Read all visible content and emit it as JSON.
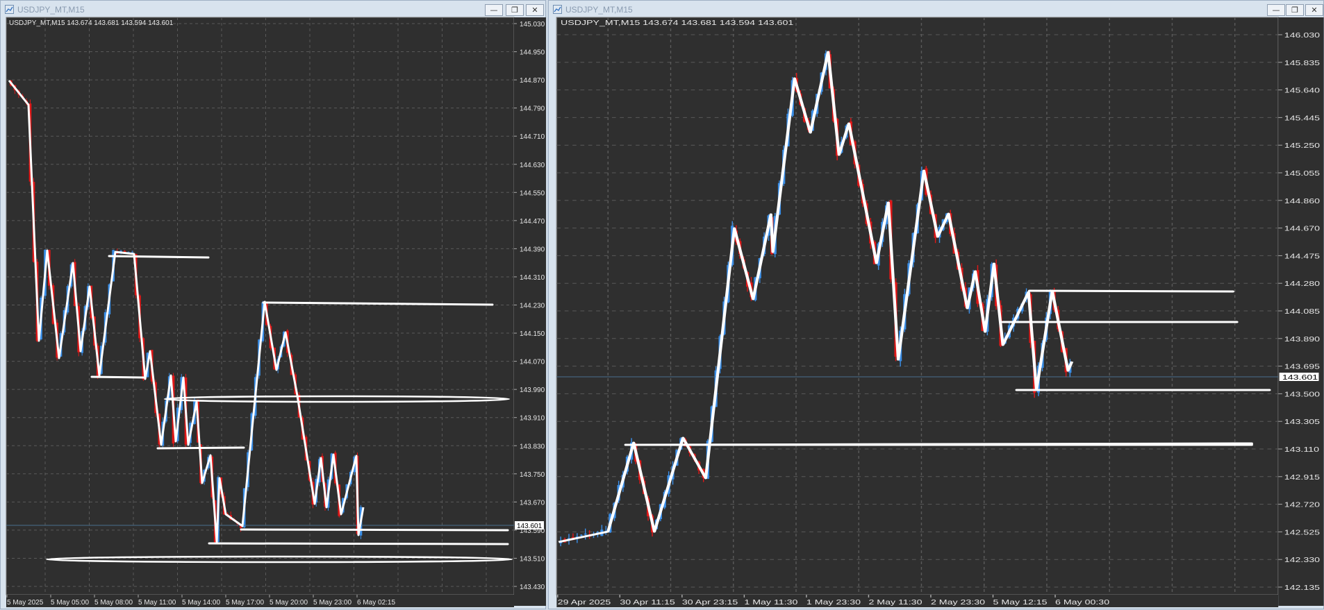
{
  "window_left": {
    "title": "USDJPY_MT,M15",
    "buttons": {
      "minimize": "—",
      "restore": "❐",
      "close": "✕"
    },
    "chart": {
      "info": "USDJPY_MT,M15  143.674 143.681 143.594 143.601",
      "price_ticks": [
        "145.030",
        "144.950",
        "144.870",
        "144.790",
        "144.710",
        "144.630",
        "144.550",
        "144.470",
        "144.390",
        "144.310",
        "144.230",
        "144.150",
        "144.070",
        "143.990",
        "143.910",
        "143.830",
        "143.750",
        "143.670",
        "143.590",
        "143.510",
        "143.430"
      ],
      "current_price": "143.601",
      "time_ticks": [
        "5 May 2025",
        "5 May 05:00",
        "5 May 08:00",
        "5 May 11:00",
        "5 May 14:00",
        "5 May 17:00",
        "5 May 20:00",
        "5 May 23:00",
        "6 May 02:15"
      ],
      "colors": {
        "bg": "#2f2f2f",
        "bull": "#3b8fe8",
        "bear": "#e01818",
        "drawing": "#ffffff"
      }
    }
  },
  "window_right": {
    "title": "USDJPY_MT,M15",
    "buttons": {
      "minimize": "—",
      "restore": "❐",
      "close": "✕"
    },
    "chart": {
      "info": "USDJPY_MT,M15  143.674 143.681 143.594 143.601",
      "price_ticks": [
        "146.030",
        "145.835",
        "145.640",
        "145.445",
        "145.250",
        "145.055",
        "144.860",
        "144.670",
        "144.475",
        "144.280",
        "144.085",
        "143.890",
        "143.695",
        "143.500",
        "143.305",
        "143.110",
        "142.915",
        "142.720",
        "142.525",
        "142.330",
        "142.135"
      ],
      "current_price": "143.601",
      "time_ticks": [
        "29 Apr 2025",
        "30 Apr 11:15",
        "30 Apr 23:15",
        "1 May 11:30",
        "1 May 23:30",
        "2 May 11:30",
        "2 May 23:30",
        "5 May 12:15",
        "6 May 00:30"
      ],
      "colors": {
        "bg": "#2f2f2f",
        "bull": "#3b8fe8",
        "bear": "#e01818",
        "drawing": "#ffffff"
      }
    }
  }
}
